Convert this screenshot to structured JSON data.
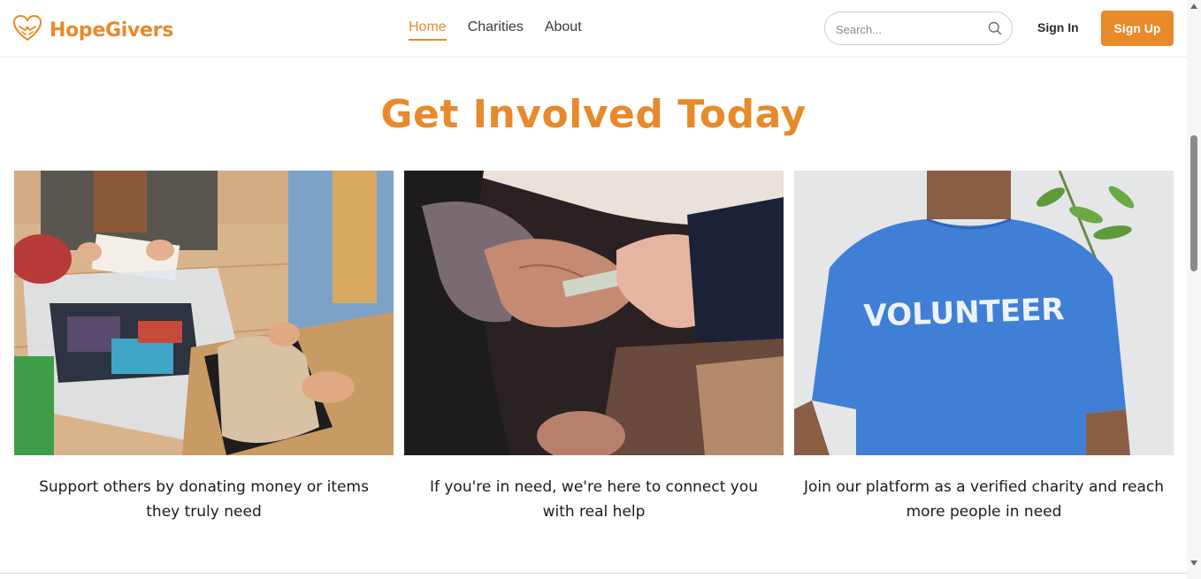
{
  "header": {
    "brand": "HopeGivers",
    "nav": [
      {
        "label": "Home",
        "active": true
      },
      {
        "label": "Charities",
        "active": false
      },
      {
        "label": "About",
        "active": false
      }
    ],
    "search_placeholder": "Search...",
    "sign_in": "Sign In",
    "sign_up": "Sign Up"
  },
  "main": {
    "title": "Get Involved Today",
    "cards": [
      {
        "image": "donating-clothes-photo",
        "caption": "Support others by donating money or items they truly need"
      },
      {
        "image": "helping-hands-photo",
        "caption": "If you're in need, we're here to connect you with real help"
      },
      {
        "image": "volunteer-shirt-photo",
        "shirt_text": "VOLUNTEER",
        "caption": "Join our platform as a verified charity and reach more people in need"
      }
    ]
  },
  "colors": {
    "brand": "#e8892a",
    "text": "#1a1a1a",
    "volunteer_shirt": "#3f7fd6"
  }
}
